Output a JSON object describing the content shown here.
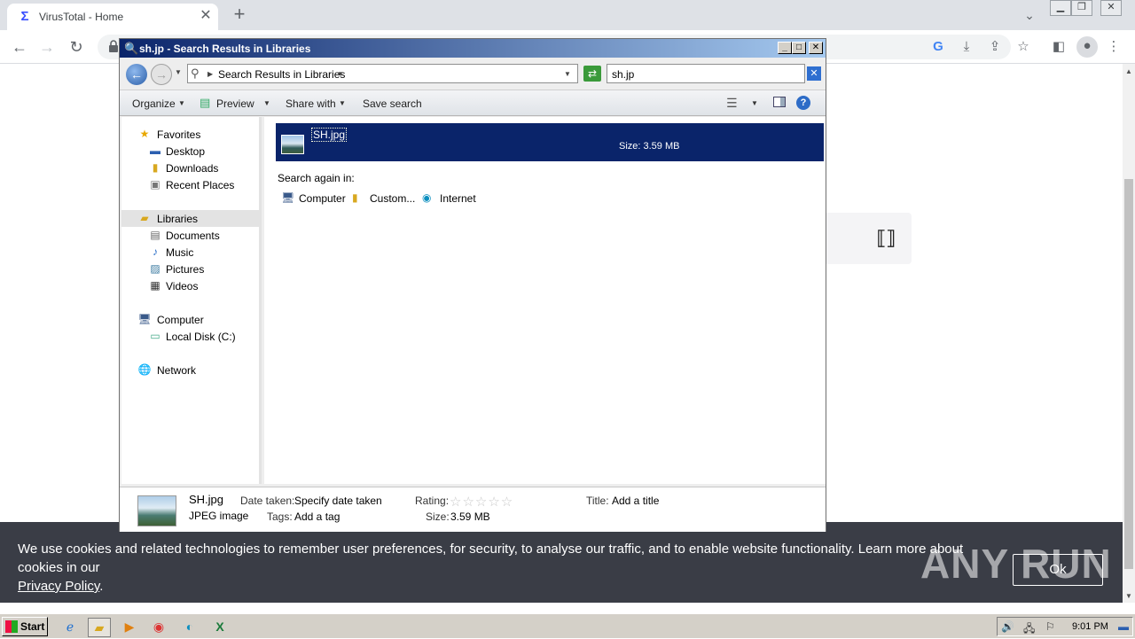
{
  "browser": {
    "tab_title": "VirusTotal - Home",
    "tab_favicon": "virustotal-icon",
    "new_tab": "+",
    "close": "✕"
  },
  "page": {
    "cookie_text": "We use cookies and related technologies to remember user preferences, for security, to analyse our traffic, and to enable website functionality. Learn more about cookies in our",
    "cookie_link": "Privacy Policy",
    "cookie_link_suffix": ".",
    "cookie_ok": "Ok",
    "watermark": "ANY RUN"
  },
  "explorer": {
    "title": "sh.jp - Search Results in Libraries",
    "address": "Search Results in Libraries",
    "search_value": "sh.jp",
    "commands": {
      "organize": "Organize",
      "preview": "Preview",
      "share_with": "Share with",
      "save_search": "Save search"
    },
    "nav": {
      "favorites": "Favorites",
      "desktop": "Desktop",
      "downloads": "Downloads",
      "recent_places": "Recent Places",
      "libraries": "Libraries",
      "documents": "Documents",
      "music": "Music",
      "pictures": "Pictures",
      "videos": "Videos",
      "computer": "Computer",
      "local_disk": "Local Disk (C:)",
      "network": "Network"
    },
    "result": {
      "name": "SH.jpg",
      "size": "Size: 3.59 MB"
    },
    "search_again": {
      "label": "Search again in:",
      "computer": "Computer",
      "custom": "Custom...",
      "internet": "Internet"
    },
    "details": {
      "file_name": "SH.jpg",
      "file_type": "JPEG image",
      "date_taken_key": "Date taken:",
      "date_taken_val": "Specify date taken",
      "tags_key": "Tags:",
      "tags_val": "Add a tag",
      "rating_key": "Rating:",
      "rating_stars": "☆☆☆☆☆",
      "size_key": "Size:",
      "size_val": "3.59 MB",
      "title_key": "Title:",
      "title_val": "Add a title"
    }
  },
  "taskbar": {
    "start": "Start",
    "clock": "9:01 PM"
  }
}
